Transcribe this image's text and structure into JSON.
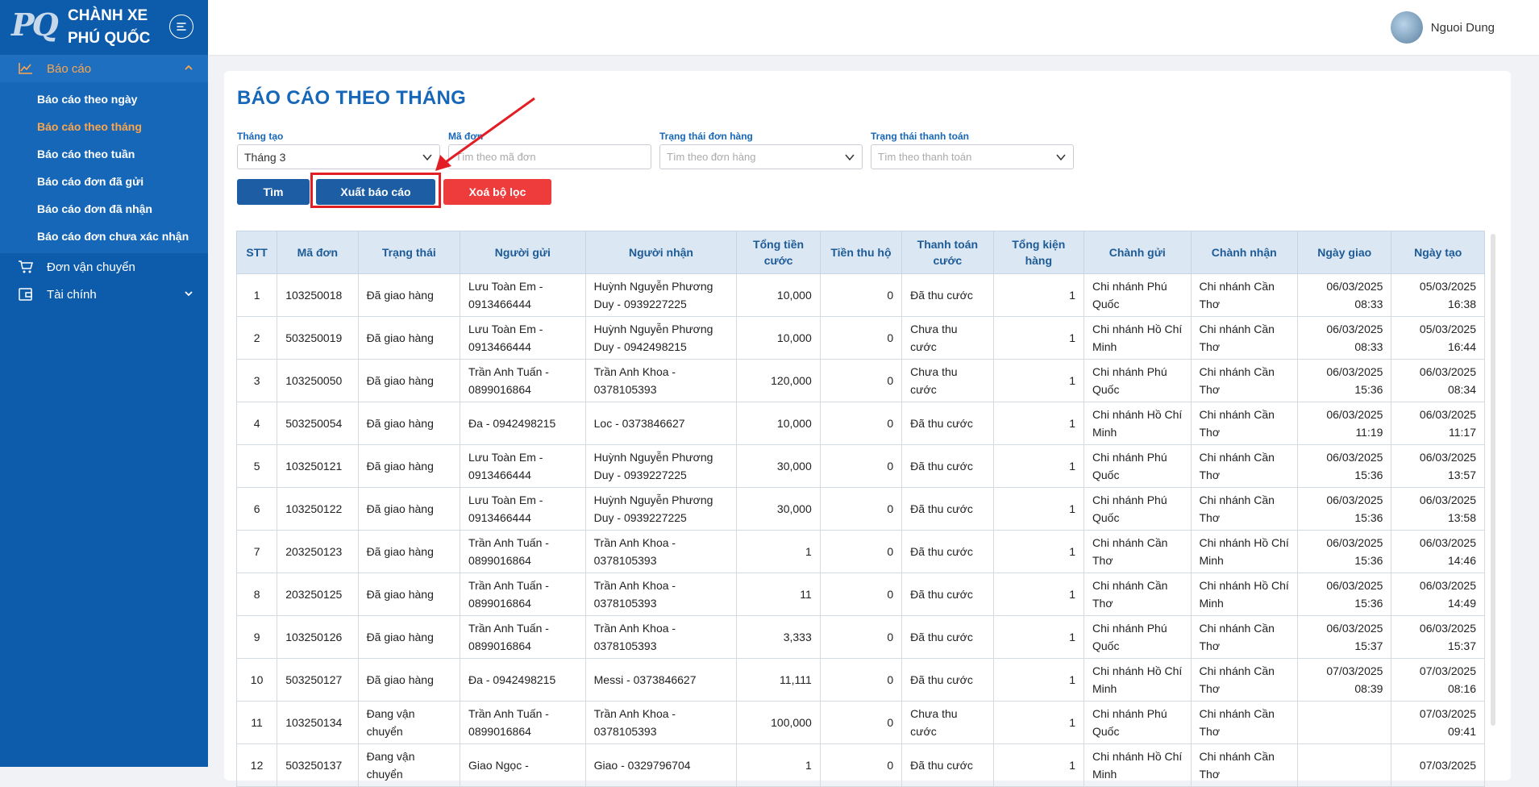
{
  "brand": {
    "logo_text": "PQ",
    "line1": "CHÀNH XE",
    "line2": "PHÚ QUỐC"
  },
  "sidebar": {
    "groups": [
      {
        "label": "Báo cáo",
        "icon": "line-chart-icon",
        "expanded": true
      },
      {
        "label": "Đơn vận chuyển",
        "icon": "cart-icon"
      },
      {
        "label": "Tài chính",
        "icon": "wallet-icon"
      }
    ],
    "report_items": [
      "Báo cáo theo ngày",
      "Báo cáo theo tháng",
      "Báo cáo theo tuần",
      "Báo cáo đơn đã gửi",
      "Báo cáo đơn đã nhận",
      "Báo cáo đơn chưa xác nhận"
    ],
    "active_item": "Báo cáo theo tháng",
    "accent_color": "#fba64c",
    "bg_color": "#0d5cab"
  },
  "topbar": {
    "user_name": "Nguoi Dung"
  },
  "page": {
    "title": "BÁO CÁO THEO THÁNG"
  },
  "filters": {
    "month": {
      "label": "Tháng tạo",
      "value": "Tháng 3"
    },
    "order_code": {
      "label": "Mã đơn",
      "placeholder": "Tìm theo mã đơn"
    },
    "order_status": {
      "label": "Trạng thái đơn hàng",
      "placeholder": "Tìm theo đơn hàng"
    },
    "payment_status": {
      "label": "Trạng thái thanh toán",
      "placeholder": "Tìm theo thanh toán"
    }
  },
  "buttons": {
    "find": "Tìm",
    "export": "Xuất báo cáo",
    "clear": "Xoá bộ lọc"
  },
  "table": {
    "headers": [
      "STT",
      "Mã đơn",
      "Trạng thái",
      "Người gửi",
      "Người nhận",
      "Tổng tiền cước",
      "Tiền thu hộ",
      "Thanh toán cước",
      "Tổng kiện hàng",
      "Chành gửi",
      "Chành nhận",
      "Ngày giao",
      "Ngày tạo"
    ],
    "rows": [
      [
        "1",
        "103250018",
        "Đã giao hàng",
        "Lưu Toàn Em - 0913466444",
        "Huỳnh Nguyễn Phương Duy - 0939227225",
        "10,000",
        "0",
        "Đã thu cước",
        "1",
        "Chi nhánh Phú Quốc",
        "Chi nhánh Cần Thơ",
        "06/03/2025 08:33",
        "05/03/2025 16:38"
      ],
      [
        "2",
        "503250019",
        "Đã giao hàng",
        "Lưu Toàn Em - 0913466444",
        "Huỳnh Nguyễn Phương Duy - 0942498215",
        "10,000",
        "0",
        "Chưa thu cước",
        "1",
        "Chi nhánh Hồ Chí Minh",
        "Chi nhánh Cần Thơ",
        "06/03/2025 08:33",
        "05/03/2025 16:44"
      ],
      [
        "3",
        "103250050",
        "Đã giao hàng",
        "Trần Anh Tuấn - 0899016864",
        "Trần Anh Khoa - 0378105393",
        "120,000",
        "0",
        "Chưa thu cước",
        "1",
        "Chi nhánh Phú Quốc",
        "Chi nhánh Cần Thơ",
        "06/03/2025 15:36",
        "06/03/2025 08:34"
      ],
      [
        "4",
        "503250054",
        "Đã giao hàng",
        "Đa - 0942498215",
        "Loc - 0373846627",
        "10,000",
        "0",
        "Đã thu cước",
        "1",
        "Chi nhánh Hồ Chí Minh",
        "Chi nhánh Cần Thơ",
        "06/03/2025 11:19",
        "06/03/2025 11:17"
      ],
      [
        "5",
        "103250121",
        "Đã giao hàng",
        "Lưu Toàn Em - 0913466444",
        "Huỳnh Nguyễn Phương Duy - 0939227225",
        "30,000",
        "0",
        "Đã thu cước",
        "1",
        "Chi nhánh Phú Quốc",
        "Chi nhánh Cần Thơ",
        "06/03/2025 15:36",
        "06/03/2025 13:57"
      ],
      [
        "6",
        "103250122",
        "Đã giao hàng",
        "Lưu Toàn Em - 0913466444",
        "Huỳnh Nguyễn Phương Duy - 0939227225",
        "30,000",
        "0",
        "Đã thu cước",
        "1",
        "Chi nhánh Phú Quốc",
        "Chi nhánh Cần Thơ",
        "06/03/2025 15:36",
        "06/03/2025 13:58"
      ],
      [
        "7",
        "203250123",
        "Đã giao hàng",
        "Trần Anh Tuấn - 0899016864",
        "Trần Anh Khoa - 0378105393",
        "1",
        "0",
        "Đã thu cước",
        "1",
        "Chi nhánh Cần Thơ",
        "Chi nhánh Hồ Chí Minh",
        "06/03/2025 15:36",
        "06/03/2025 14:46"
      ],
      [
        "8",
        "203250125",
        "Đã giao hàng",
        "Trần Anh Tuấn - 0899016864",
        "Trần Anh Khoa - 0378105393",
        "11",
        "0",
        "Đã thu cước",
        "1",
        "Chi nhánh Cần Thơ",
        "Chi nhánh Hồ Chí Minh",
        "06/03/2025 15:36",
        "06/03/2025 14:49"
      ],
      [
        "9",
        "103250126",
        "Đã giao hàng",
        "Trần Anh Tuấn - 0899016864",
        "Trần Anh Khoa - 0378105393",
        "3,333",
        "0",
        "Đã thu cước",
        "1",
        "Chi nhánh Phú Quốc",
        "Chi nhánh Cần Thơ",
        "06/03/2025 15:37",
        "06/03/2025 15:37"
      ],
      [
        "10",
        "503250127",
        "Đã giao hàng",
        "Đa - 0942498215",
        "Messi - 0373846627",
        "11,111",
        "0",
        "Đã thu cước",
        "1",
        "Chi nhánh Hồ Chí Minh",
        "Chi nhánh Cần Thơ",
        "07/03/2025 08:39",
        "07/03/2025 08:16"
      ],
      [
        "11",
        "103250134",
        "Đang vận chuyển",
        "Trần Anh Tuấn - 0899016864",
        "Trần Anh Khoa - 0378105393",
        "100,000",
        "0",
        "Chưa thu cước",
        "1",
        "Chi nhánh Phú Quốc",
        "Chi nhánh Cần Thơ",
        "",
        "07/03/2025 09:41"
      ],
      [
        "12",
        "503250137",
        "Đang vận chuyển",
        "Giao Ngọc -",
        "Giao - 0329796704",
        "1",
        "0",
        "Đã thu cước",
        "1",
        "Chi nhánh Hồ Chí Minh",
        "Chi nhánh Cần Thơ",
        "",
        "07/03/2025"
      ]
    ]
  }
}
